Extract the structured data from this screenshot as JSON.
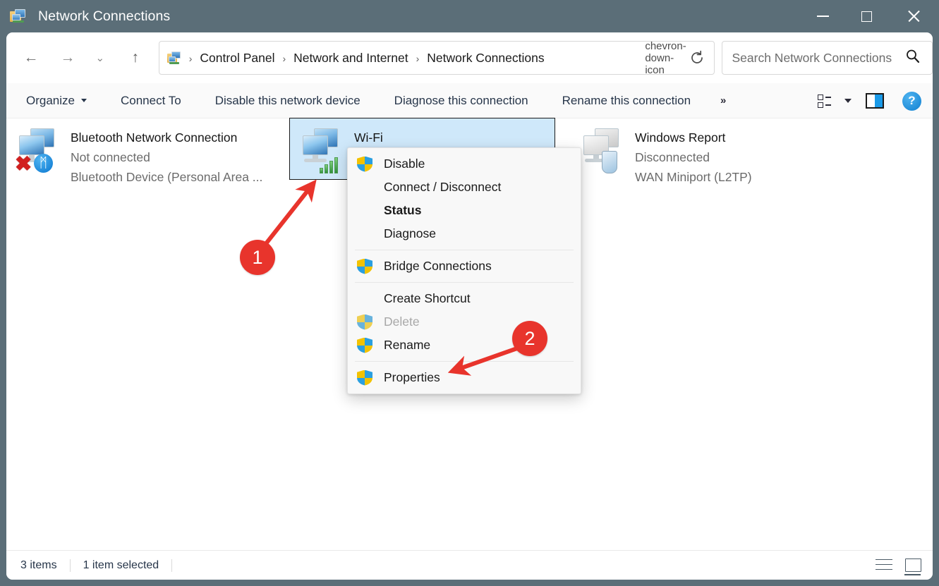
{
  "window": {
    "title": "Network Connections",
    "title_icon": "network-connections-icon",
    "controls": {
      "minimize": "minimize-icon",
      "maximize": "maximize-icon",
      "close": "close-icon"
    }
  },
  "nav": {
    "back": "←",
    "forward": "→",
    "recent": "⌄",
    "up": "↑"
  },
  "address": {
    "icon": "network-connections-icon",
    "crumbs": [
      "Control Panel",
      "Network and Internet",
      "Network Connections"
    ],
    "separator": "›",
    "dropdown": "chevron-down-icon",
    "refresh": "refresh-icon"
  },
  "search": {
    "placeholder": "Search Network Connections",
    "value": "",
    "icon": "search-icon"
  },
  "commandbar": {
    "items": [
      {
        "label": "Organize",
        "has_caret": true
      },
      {
        "label": "Connect To",
        "has_caret": false
      },
      {
        "label": "Disable this network device",
        "has_caret": false
      },
      {
        "label": "Diagnose this connection",
        "has_caret": false
      },
      {
        "label": "Rename this connection",
        "has_caret": false
      }
    ],
    "overflow": "»",
    "view_button": "view-options-icon",
    "preview_pane": "preview-pane-icon",
    "help": "?"
  },
  "connections": [
    {
      "name": "Bluetooth Network Connection",
      "status": "Not connected",
      "device": "Bluetooth Device (Personal Area ...",
      "icon": "network-adapter-icon",
      "overlay": "bluetooth-badge",
      "error_badge": "✖",
      "bluetooth_glyph": "ᛗ",
      "selected": false
    },
    {
      "name": "Wi-Fi",
      "status": "",
      "device": "",
      "icon": "network-adapter-icon",
      "overlay": "signal-bars-badge",
      "selected": true
    },
    {
      "name": "Windows Report",
      "status": "Disconnected",
      "device": "WAN Miniport (L2TP)",
      "icon": "vpn-adapter-icon",
      "overlay": "vpn-plug-badge",
      "selected": false
    }
  ],
  "context_menu": {
    "groups": [
      [
        {
          "label": "Disable",
          "shield": true,
          "bold": false,
          "disabled": false
        },
        {
          "label": "Connect / Disconnect",
          "shield": false,
          "bold": false,
          "disabled": false
        },
        {
          "label": "Status",
          "shield": false,
          "bold": true,
          "disabled": false
        },
        {
          "label": "Diagnose",
          "shield": false,
          "bold": false,
          "disabled": false
        }
      ],
      [
        {
          "label": "Bridge Connections",
          "shield": true,
          "bold": false,
          "disabled": false
        }
      ],
      [
        {
          "label": "Create Shortcut",
          "shield": false,
          "bold": false,
          "disabled": false
        },
        {
          "label": "Delete",
          "shield": true,
          "bold": false,
          "disabled": true
        },
        {
          "label": "Rename",
          "shield": true,
          "bold": false,
          "disabled": false
        }
      ],
      [
        {
          "label": "Properties",
          "shield": true,
          "bold": false,
          "disabled": false
        }
      ]
    ]
  },
  "annotations": [
    {
      "number": "1",
      "target": "wi-fi-item"
    },
    {
      "number": "2",
      "target": "properties-menu-item"
    }
  ],
  "statusbar": {
    "item_count": "3 items",
    "selection": "1 item selected",
    "details_view": "details-view-icon",
    "large_icons_view": "large-icons-view-icon"
  },
  "colors": {
    "titlebar": "#5b6e78",
    "selection": "#cfe8fa",
    "accent": "#1a9ae8",
    "annotation": "#e8342c"
  }
}
